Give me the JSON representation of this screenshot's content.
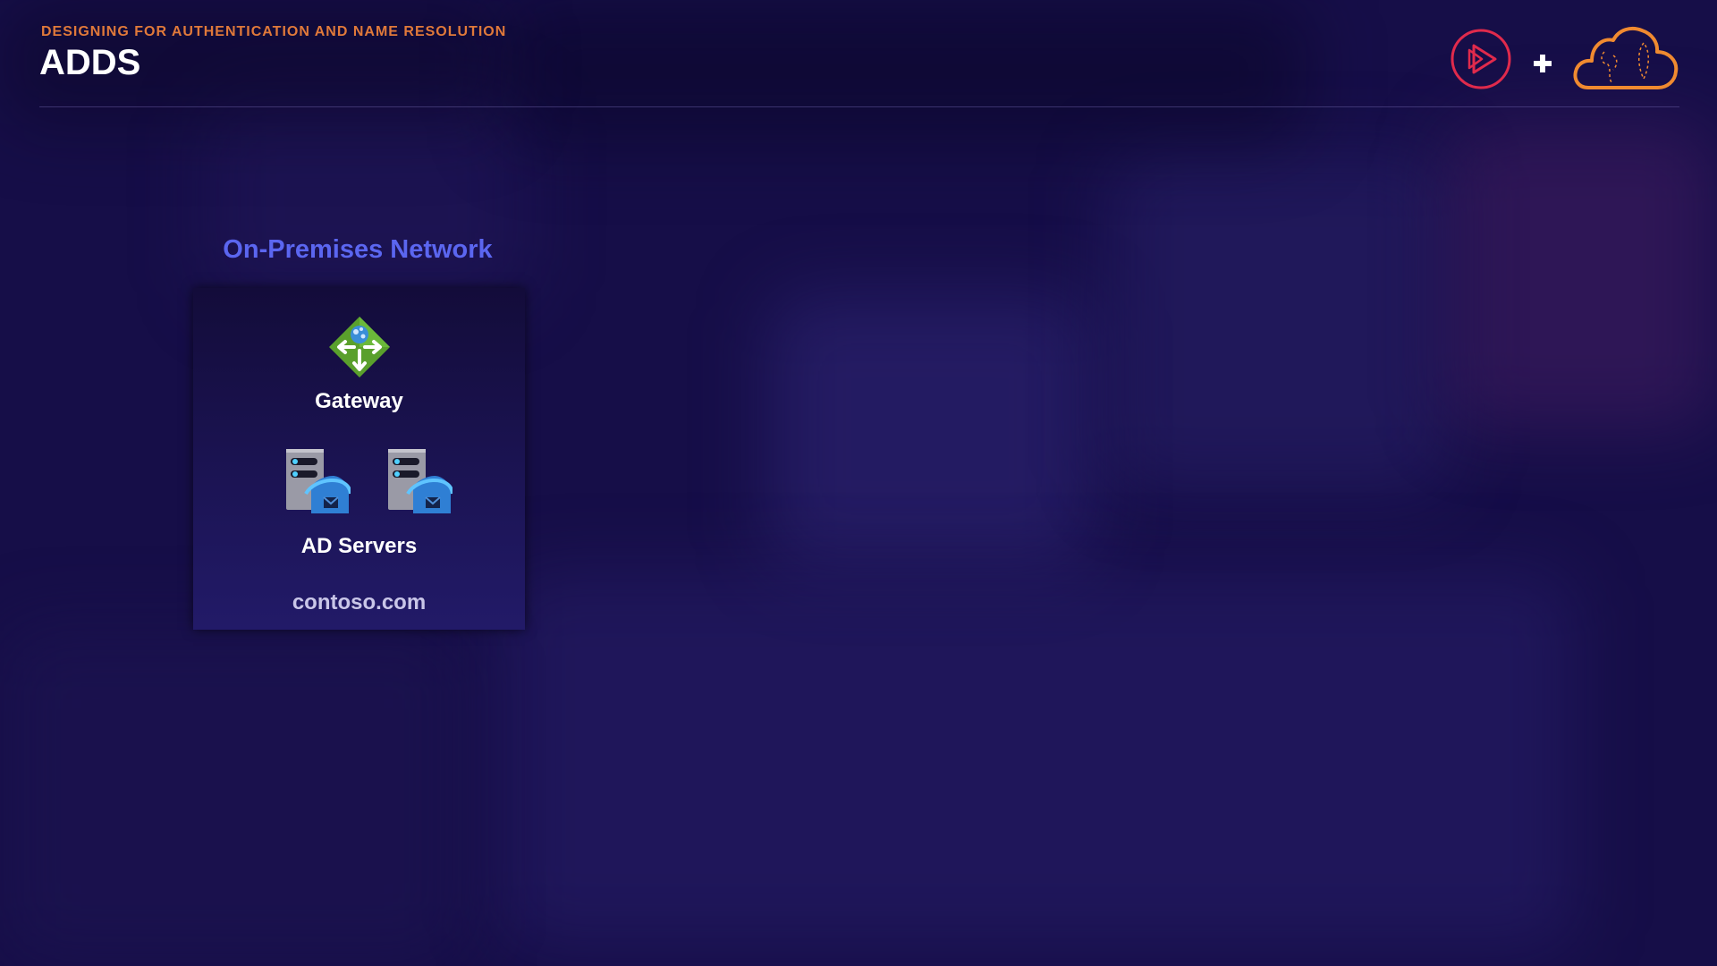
{
  "header": {
    "subtitle": "DESIGNING FOR AUTHENTICATION AND NAME RESOLUTION",
    "title": "ADDS"
  },
  "logos": {
    "left_icon": "play-circle-icon",
    "separator": "plus-icon",
    "right_icon": "cloud-icon"
  },
  "network": {
    "label": "On-Premises Network",
    "gateway": {
      "icon": "gateway-icon",
      "label": "Gateway"
    },
    "servers": {
      "icon": "ad-server-icon",
      "count": 2,
      "label": "AD Servers"
    },
    "domain": "contoso.com"
  },
  "colors": {
    "background": "#160e48",
    "accent_orange": "#e0793a",
    "network_label": "#5b66f0",
    "logo_red": "#e02a4c",
    "gateway_green": "#5aa02c"
  }
}
